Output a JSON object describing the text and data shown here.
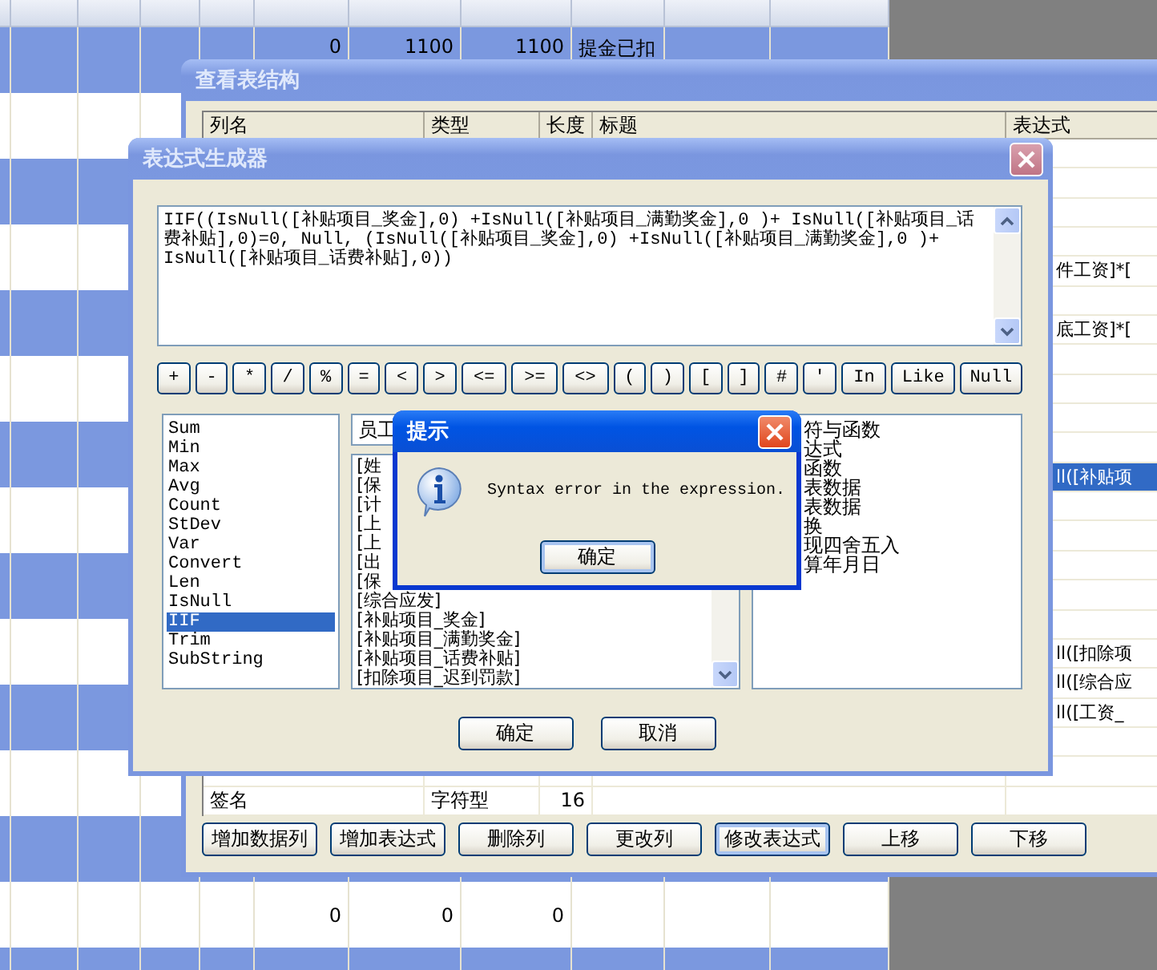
{
  "background_table": {
    "top_row": {
      "amounts": [
        "0",
        "1100",
        "1100"
      ],
      "remark": "提金已扣"
    },
    "bottom_row": {
      "amounts": [
        "0",
        "0",
        "0"
      ]
    }
  },
  "table_structure_window": {
    "title": "查看表结构",
    "columns": [
      "列名",
      "类型",
      "长度",
      "标题",
      "表达式"
    ],
    "rows": [
      {
        "selected": false
      },
      {
        "selected": false
      },
      {
        "selected": false
      },
      {
        "selected": false
      },
      {
        "expression": "件工资]*[",
        "selected": false
      },
      {
        "selected": false
      },
      {
        "expression": "底工资]*[",
        "selected": false
      },
      {
        "selected": false
      },
      {
        "selected": false
      },
      {
        "selected": false
      },
      {
        "selected": false
      },
      {
        "expression": "ll([补贴项",
        "selected": true
      },
      {
        "selected": false
      },
      {
        "selected": false
      },
      {
        "selected": false
      },
      {
        "selected": false
      },
      {
        "selected": false
      },
      {
        "expression": "ll([扣除项",
        "selected": false
      },
      {
        "expression": "ll([综合应",
        "selected": false
      },
      {
        "expression": "ll([工资_",
        "selected": false
      },
      {
        "selected": false
      },
      {
        "selected": false
      },
      {
        "name": "签名",
        "type": "字符型",
        "length": "16",
        "selected": false
      }
    ],
    "buttons": [
      {
        "label": "增加数据列",
        "focused": false
      },
      {
        "label": "增加表达式",
        "focused": false
      },
      {
        "label": "删除列",
        "focused": false
      },
      {
        "label": "更改列",
        "focused": false
      },
      {
        "label": "修改表达式",
        "focused": true
      },
      {
        "label": "上移",
        "focused": false
      },
      {
        "label": "下移",
        "focused": false
      }
    ]
  },
  "expression_builder": {
    "title": "表达式生成器",
    "expression": "IIF((IsNull([补贴项目_奖金],0) +IsNull([补贴项目_满勤奖金],0 )+ IsNull([补贴项目_话费补贴],0)=0, Null, (IsNull([补贴项目_奖金],0) +IsNull([补贴项目_满勤奖金],0 )+ IsNull([补贴项目_话费补贴],0))",
    "operators": [
      "+",
      "-",
      "*",
      "/",
      "%",
      "=",
      "<",
      ">",
      "<=",
      ">=",
      "<>",
      "(",
      ")",
      "[",
      "]",
      "#",
      "'",
      "In",
      "Like",
      "Null"
    ],
    "functions": [
      {
        "label": "Sum",
        "selected": false
      },
      {
        "label": "Min",
        "selected": false
      },
      {
        "label": "Max",
        "selected": false
      },
      {
        "label": "Avg",
        "selected": false
      },
      {
        "label": "Count",
        "selected": false
      },
      {
        "label": "StDev",
        "selected": false
      },
      {
        "label": "Var",
        "selected": false
      },
      {
        "label": "Convert",
        "selected": false
      },
      {
        "label": "Len",
        "selected": false
      },
      {
        "label": "IsNull",
        "selected": false
      },
      {
        "label": "IIF",
        "selected": true
      },
      {
        "label": "Trim",
        "selected": false
      },
      {
        "label": "SubString",
        "selected": false
      }
    ],
    "field_group": "员工",
    "fields": [
      "[姓",
      "[保",
      "[计",
      "[上",
      "[上",
      "[出",
      "[保",
      "[综合应发]",
      "[补贴项目_奖金]",
      "[补贴项目_满勤奖金]",
      "[补贴项目_话费补贴]",
      "[扣除项目_迟到罚款]"
    ],
    "categories": [
      "符与函数",
      "达式",
      "函数",
      "表数据",
      "表数据",
      "换",
      "现四舍五入",
      "算年月日"
    ],
    "buttons": [
      "确定",
      "取消"
    ]
  },
  "alert": {
    "title": "提示",
    "message": "Syntax error in the expression.",
    "button": "确定"
  }
}
